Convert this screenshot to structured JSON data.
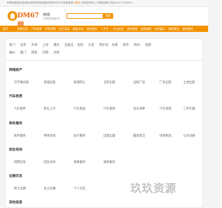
{
  "topbar": {
    "text_a": "阿坝免费发布信息网,阿坝供求信息网,阿坝DM67分类信息网",
    "link": "[登录]",
    "text_b": "欢迎您来到",
    "text_c": "分类信息网 电话:2017-000000"
  },
  "header": {
    "logo_text": "DM67网",
    "city": "阿坝",
    "city_sub": "[切换其他城市]",
    "search_placeholder": "",
    "search_button": "搜索"
  },
  "nav": [
    "首页",
    "房屋信息",
    "汽车租赁",
    "求职招聘",
    "招生培训",
    "跳蚤市场",
    "商务服务",
    "二手车",
    "农业信息",
    "餐饮美食",
    "旅游度假",
    "休闲娱乐",
    "美容美发",
    "装修建材"
  ],
  "cities": {
    "row1": [
      "热门",
      "北京",
      "天津",
      "上海",
      "重庆",
      "石家庄",
      "沈阳",
      "大连",
      "哈尔滨",
      "长春",
      "南京",
      "杭州",
      "合肥"
    ],
    "row2": [
      "福州",
      "厦门",
      "南昌",
      "济南",
      "太原"
    ]
  },
  "sections": [
    {
      "title": "商铺房产",
      "items": [
        "写字楼出租",
        "商铺出售",
        "商铺转让",
        "仓库出租",
        "出租厂房",
        "厂房出售",
        "土地出售"
      ]
    },
    {
      "title": "汽车租赁",
      "items": [
        "汽车配件",
        "新车上市",
        "汽车用品",
        "汽车维修",
        "洗车保养",
        "汽车装饰",
        "二手车辆"
      ]
    },
    {
      "title": "商务服务",
      "items": [
        "商务服务",
        "律师咨询",
        "会计服务",
        "出版出版",
        "搬家保洁",
        "快递物流",
        "公司注册"
      ]
    },
    {
      "title": "招生培训",
      "items": [
        "招聘信息",
        "招生培训",
        "家教服务",
        "家政服务"
      ]
    },
    {
      "title": "征婚交友",
      "items": [
        "男士征婚",
        "女士征婚",
        "个人交友"
      ]
    },
    {
      "title": "其他信息",
      "items": []
    }
  ],
  "watermark": "玖玖资源"
}
